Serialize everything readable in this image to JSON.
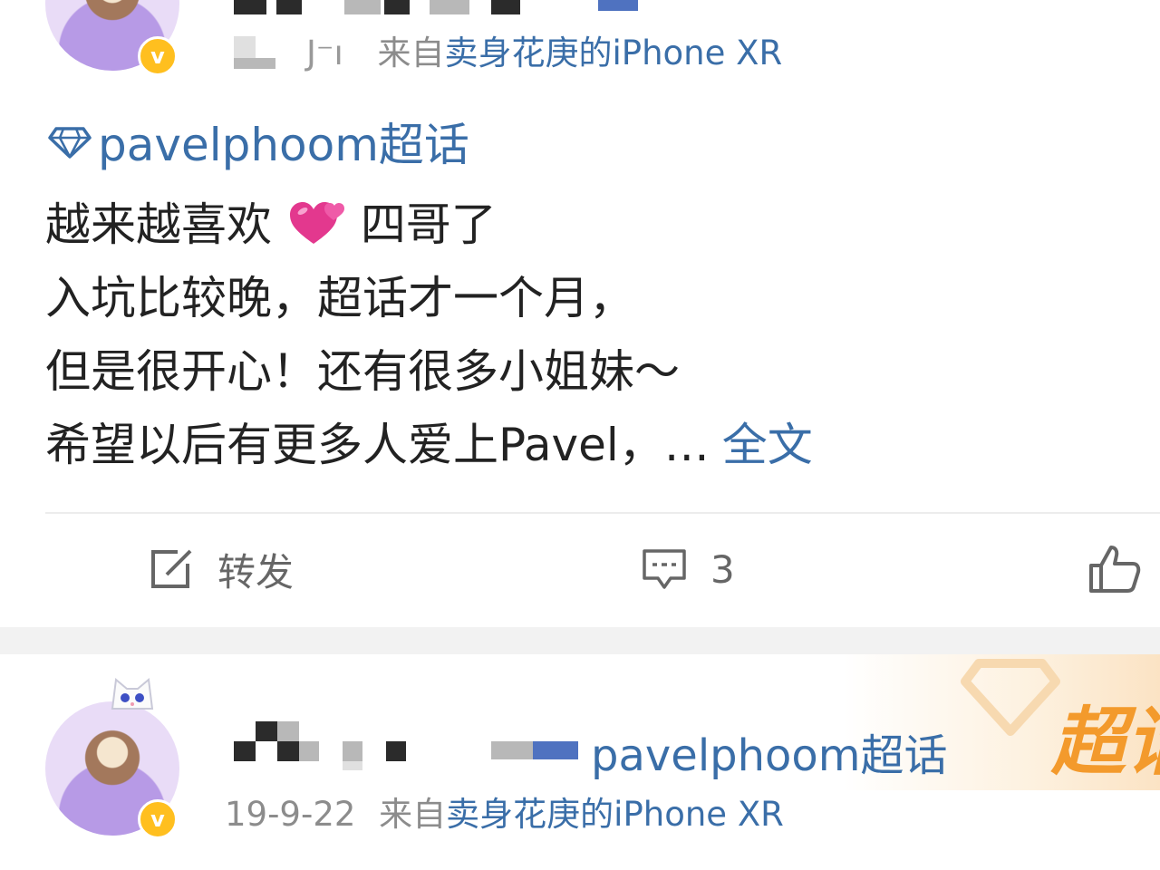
{
  "post1": {
    "meta_prefix": "来自",
    "source": "卖身花庚的iPhone XR",
    "topic": "pavelphoom超话",
    "lines": [
      "越来越喜欢",
      "四哥了",
      "入坑比较晚，超话才一个月，",
      "但是很开心！还有很多小姐妹～",
      "希望以后有更多人爱上Pavel，…"
    ],
    "more_label": "全文",
    "actions": {
      "repost_label": "转发",
      "comment_count": "3"
    }
  },
  "post2": {
    "topic": "pavelphoom超话",
    "date": "19-9-22",
    "meta_prefix": "来自",
    "source": "卖身花庚的iPhone XR",
    "promo_text": "超话"
  },
  "icons": {
    "verified": "v-badge-icon",
    "topic": "diamond-icon",
    "repost": "edit-share-icon",
    "comment": "comment-icon",
    "like": "thumbs-up-icon",
    "emoji": "two-hearts-emoji"
  },
  "colors": {
    "link": "#3a6ea8",
    "badge": "#ffbf1f",
    "promo": "#f39a2c"
  }
}
